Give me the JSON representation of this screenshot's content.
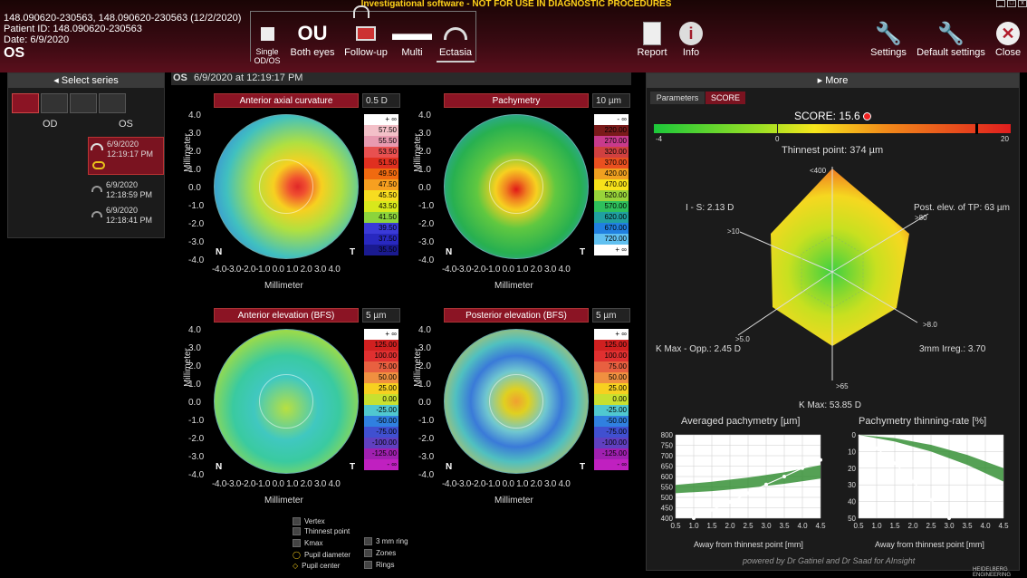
{
  "header": {
    "warning": "Investigational software - NOT FOR USE IN DIAGNOSTIC PROCEDURES",
    "patient_line": "148.090620-230563, 148.090620-230563 (12/2/2020)",
    "patient_id": "Patient ID: 148.090620-230563",
    "date": "Date: 6/9/2020",
    "eye": "OS",
    "tools": [
      {
        "label": "Single OD/OS",
        "icon": "single-icon"
      },
      {
        "label": "Both eyes",
        "icon": "both-eyes-icon"
      },
      {
        "label": "Follow-up",
        "icon": "follow-up-icon"
      },
      {
        "label": "Multi",
        "icon": "multi-icon"
      },
      {
        "label": "Ectasia",
        "icon": "ectasia-icon"
      }
    ],
    "right_tools": [
      {
        "label": "Report",
        "icon": "report-icon"
      },
      {
        "label": "Info",
        "icon": "info-icon"
      },
      {
        "label": "Settings",
        "icon": "wrench-icon"
      },
      {
        "label": "Default settings",
        "icon": "wrench-icon"
      },
      {
        "label": "Close",
        "icon": "close-icon"
      }
    ]
  },
  "sidebar": {
    "title": "Select series",
    "col_od": "OD",
    "col_os": "OS",
    "series": [
      {
        "date": "6/9/2020",
        "time": "12:19:17 PM"
      },
      {
        "date": "6/9/2020",
        "time": "12:18:59 PM"
      },
      {
        "date": "6/9/2020",
        "time": "12:18:41 PM"
      }
    ]
  },
  "main": {
    "title_eye": "OS",
    "title_date": "6/9/2020 at 12:19:17 PM",
    "maps": [
      {
        "title": "Anterior axial curvature",
        "unit": "0.5 D",
        "scale": [
          "+ ∞",
          "57.50",
          "55.50",
          "53.50",
          "51.50",
          "49.50",
          "47.50",
          "45.50",
          "43.50",
          "41.50",
          "39.50",
          "37.50",
          "35.50"
        ]
      },
      {
        "title": "Pachymetry",
        "unit": "10 µm",
        "scale": [
          "- ∞",
          "220.00",
          "270.00",
          "320.00",
          "370.00",
          "420.00",
          "470.00",
          "520.00",
          "570.00",
          "620.00",
          "670.00",
          "720.00",
          "+ ∞"
        ]
      },
      {
        "title": "Anterior elevation (BFS)",
        "unit": "5 µm",
        "scale": [
          "+ ∞",
          "125.00",
          "100.00",
          "75.00",
          "50.00",
          "25.00",
          "0.00",
          "-25.00",
          "-50.00",
          "-75.00",
          "-100.00",
          "-125.00",
          "- ∞"
        ]
      },
      {
        "title": "Posterior elevation (BFS)",
        "unit": "5 µm",
        "scale": [
          "+ ∞",
          "125.00",
          "100.00",
          "75.00",
          "50.00",
          "25.00",
          "0.00",
          "-25.00",
          "-50.00",
          "-75.00",
          "-100.00",
          "-125.00",
          "- ∞"
        ]
      }
    ],
    "y_ticks": [
      "4.0",
      "3.0",
      "2.0",
      "1.0",
      "0.0",
      "-1.0",
      "-2.0",
      "-3.0",
      "-4.0"
    ],
    "x_ticks": "-4.0-3.0-2.0-1.0 0.0 1.0 2.0 3.0 4.0",
    "axis_label": "Millimeter",
    "nasal": "N",
    "temporal": "T"
  },
  "legend": {
    "vertex": "Vertex",
    "thinnest": "Thinnest point",
    "kmax": "Kmax",
    "pupil_d": "Pupil diameter",
    "pupil_c": "Pupil center",
    "ring3": "3 mm ring",
    "zones": "Zones",
    "rings": "Rings"
  },
  "right": {
    "title": "More",
    "tabs": [
      "Parameters",
      "SCORE"
    ],
    "score": "SCORE: 15.6",
    "bar_min": "-4",
    "bar_zero": "0",
    "bar_max": "20",
    "thinnest": "Thinnest point: 374 µm",
    "labels": {
      "is": "I - S: 2.13 D",
      "post": "Post. elev. of TP: 63 µm",
      "kmaxopp": "K Max - Opp.: 2.45 D",
      "irreg": "3mm Irreg.: 3.70",
      "kmax": "K Max: 53.85 D"
    },
    "axis_limits": [
      ">10",
      "<400",
      ">80",
      ">8.0",
      ">65",
      ">5.0"
    ],
    "chart1": {
      "title": "Averaged pachymetry [µm]",
      "xlabel": "Away from thinnest point [mm]"
    },
    "chart2": {
      "title": "Pachymetry thinning-rate [%]",
      "xlabel": "Away from thinnest point [mm]"
    },
    "credit": "powered by Dr Gatinel and Dr Saad for AInsight",
    "logo": "HEIDELBERG ENGINEERING"
  },
  "chart_data": [
    {
      "type": "line",
      "title": "Averaged pachymetry [µm]",
      "xlabel": "Away from thinnest point [mm]",
      "ylabel": "",
      "x": [
        1.0,
        1.5,
        2.0,
        2.5,
        3.0,
        3.5,
        4.0,
        4.5
      ],
      "series": [
        {
          "values": [
            400,
            440,
            478,
            520,
            562,
            600,
            640,
            680
          ]
        }
      ],
      "xlim": [
        0.5,
        4.5
      ],
      "ylim": [
        400,
        800
      ],
      "yticks": [
        400,
        450,
        500,
        550,
        600,
        650,
        700,
        750,
        800
      ]
    },
    {
      "type": "line",
      "title": "Pachymetry thinning-rate [%]",
      "xlabel": "Away from thinnest point [mm]",
      "ylabel": "",
      "x": [
        1.0,
        1.5,
        2.0,
        2.5,
        3.0
      ],
      "series": [
        {
          "values": [
            8,
            17,
            28,
            39,
            50
          ]
        }
      ],
      "xlim": [
        0.5,
        4.5
      ],
      "ylim": [
        0,
        50
      ],
      "yticks": [
        0,
        10,
        20,
        30,
        40,
        50
      ]
    }
  ]
}
